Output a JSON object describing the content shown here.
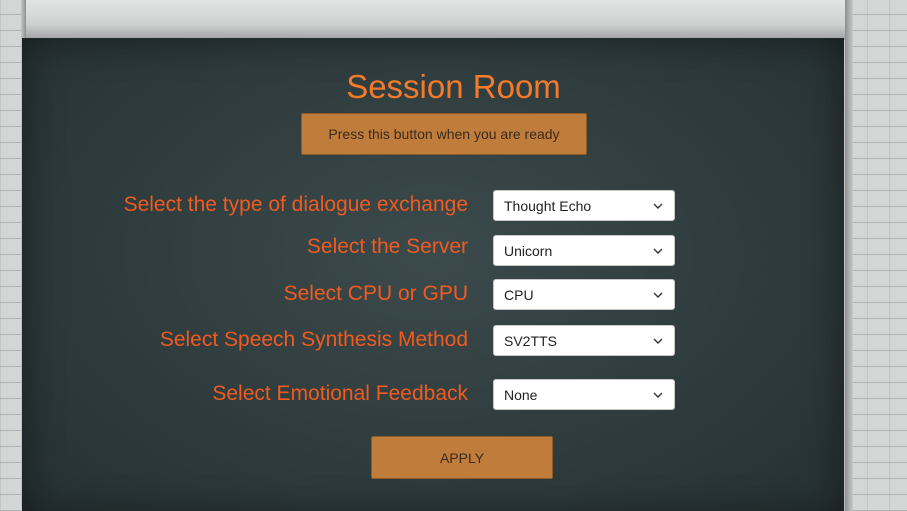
{
  "title": "Session Room",
  "ready_button": "Press this button when you are ready",
  "settings": [
    {
      "label": "Select the type of dialogue exchange",
      "value": "Thought Echo"
    },
    {
      "label": "Select the Server",
      "value": "Unicorn"
    },
    {
      "label": "Select CPU or GPU",
      "value": "CPU"
    },
    {
      "label": "Select Speech Synthesis Method",
      "value": "SV2TTS"
    },
    {
      "label": "Select Emotional Feedback",
      "value": "None"
    }
  ],
  "apply_button": "APPLY",
  "icons": {
    "dropdown": "chevron-down-icon"
  },
  "colors": {
    "title": "#f47a2a",
    "label": "#f25a1e",
    "button": "#c07c3b",
    "board": "#2f3c3e"
  }
}
